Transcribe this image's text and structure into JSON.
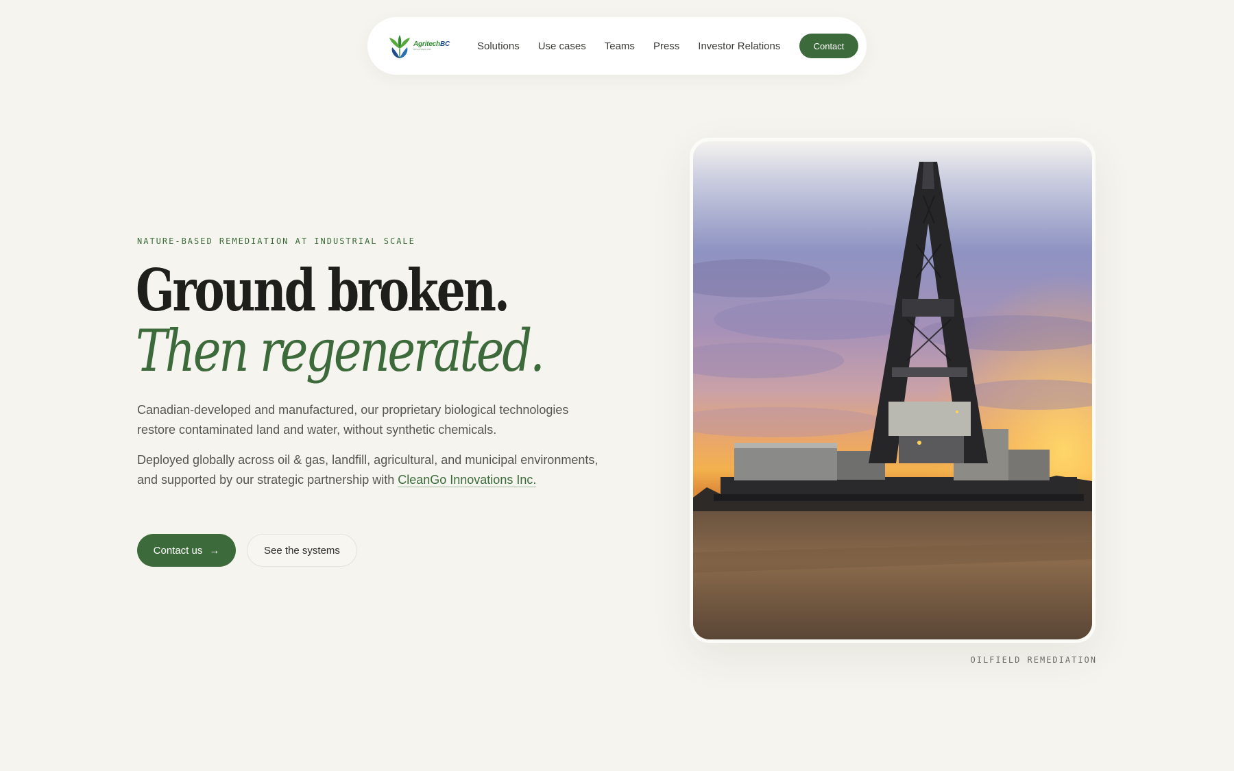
{
  "nav": {
    "logo": {
      "word_a": "Agritech",
      "word_b": "BC",
      "sub": "SOLUTIONS INC."
    },
    "links": [
      "Solutions",
      "Use cases",
      "Teams",
      "Press",
      "Investor Relations"
    ],
    "cta_label": "Contact"
  },
  "hero": {
    "eyebrow": "NATURE-BASED REMEDIATION AT INDUSTRIAL SCALE",
    "headline_line1": "Ground broken.",
    "headline_line2": "Then regenerated.",
    "body1": "Canadian-developed and manufactured, our proprietary biological technologies restore contaminated land and water, without synthetic chemicals.",
    "body2_prefix": "Deployed globally across oil & gas, landfill, agricultural, and municipal environments, and supported by our strategic partnership with ",
    "partner_link": "CleanGo Innovations Inc.",
    "primary_button": "Contact us",
    "primary_button_icon": "arrow-right-icon",
    "secondary_button": "See the systems",
    "image_caption": "OILFIELD REMEDIATION"
  },
  "colors": {
    "background": "#f5f4ef",
    "brand_green": "#3c6a3a",
    "text_dark": "#1e1e1b",
    "text_body": "#55544e"
  }
}
